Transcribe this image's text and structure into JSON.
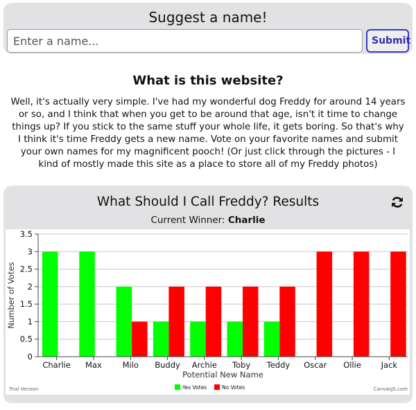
{
  "suggest": {
    "title": "Suggest a name!",
    "placeholder": "Enter a name...",
    "submit_label": "Submit"
  },
  "about": {
    "title": "What is this website?",
    "text": "Well, it's actually very simple. I've had my wonderful dog Freddy for around 14 years or so, and I think that when you get to be around that age, isn't it time to change things up? If you stick to the same stuff your whole life, it gets boring. So that's why I think it's time Freddy gets a new name. Vote on your favorite names and submit your own names for my magnificent pooch! (Or just click through the pictures - I kind of mostly made this site as a place to store all of my Freddy photos)"
  },
  "results": {
    "title": "What Should I Call Freddy? Results",
    "winner_label": "Current Winner:",
    "winner_name": "Charlie",
    "refresh_icon": "refresh-icon",
    "trial_text": "Trial Version",
    "credit_text": "CanvasJS.com"
  },
  "colors": {
    "yes": "#00ff00",
    "no": "#ff0000"
  },
  "chart_data": {
    "type": "bar",
    "xlabel": "Potential New Name",
    "ylabel": "Number of Votes",
    "ylim": [
      0,
      3.5
    ],
    "yticks": [
      0,
      0.5,
      1,
      1.5,
      2,
      2.5,
      3,
      3.5
    ],
    "ytick_labels": [
      "0",
      "0.5",
      "1",
      "1.5",
      "2",
      "2.5",
      "3",
      "3.5"
    ],
    "categories": [
      "Charlie",
      "Max",
      "Milo",
      "Buddy",
      "Archie",
      "Toby",
      "Teddy",
      "Oscar",
      "Ollie",
      "Jack"
    ],
    "series": [
      {
        "name": "Yes Votes",
        "color": "#00ff00",
        "values": [
          3,
          3,
          2,
          1,
          1,
          1,
          1,
          0,
          0,
          0
        ]
      },
      {
        "name": "No Votes",
        "color": "#ff0000",
        "values": [
          0,
          0,
          1,
          2,
          2,
          2,
          2,
          3,
          3,
          3
        ]
      }
    ],
    "grid": true,
    "legend": "bottom-center"
  }
}
